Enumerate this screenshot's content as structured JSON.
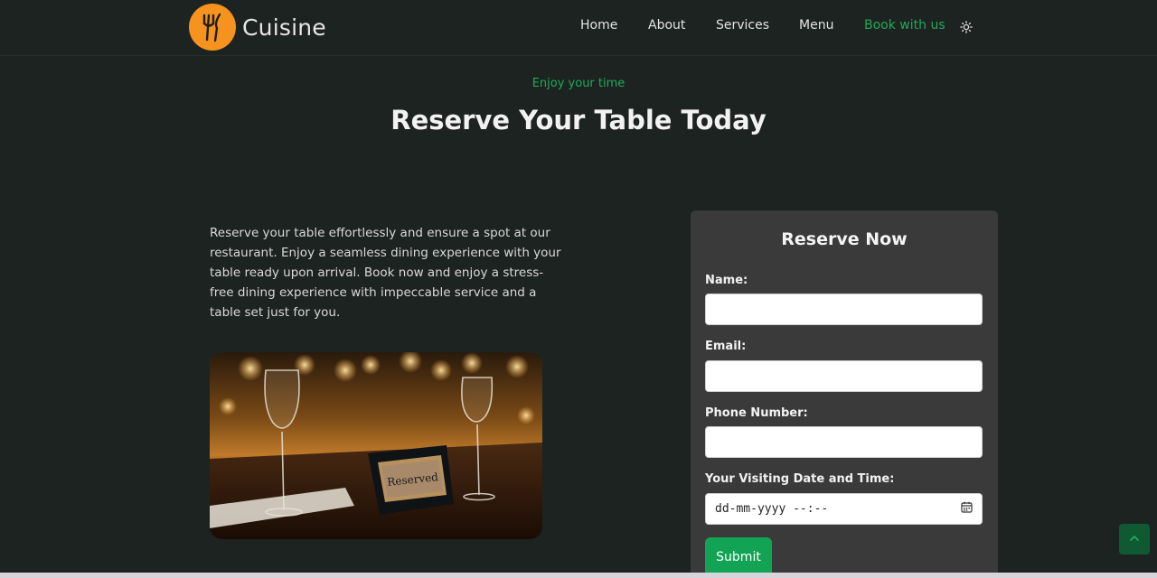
{
  "brand": {
    "name": "Cuisine"
  },
  "nav": {
    "items": [
      {
        "label": "Home"
      },
      {
        "label": "About"
      },
      {
        "label": "Services"
      },
      {
        "label": "Menu"
      },
      {
        "label": "Book with us"
      }
    ],
    "active": "Book with us"
  },
  "hero": {
    "eyebrow": "Enjoy your time",
    "title": "Reserve Your Table Today"
  },
  "intro": {
    "text": "Reserve your table effortlessly and ensure a spot at our restaurant. Enjoy a seamless dining experience with your table ready upon arrival. Book now and enjoy a stress-free dining experience with impeccable service and a table set just for you."
  },
  "photo": {
    "sign_text": "Reserved"
  },
  "form": {
    "title": "Reserve Now",
    "name_label": "Name:",
    "email_label": "Email:",
    "phone_label": "Phone Number:",
    "datetime_label": "Your Visiting Date and Time:",
    "datetime_placeholder": "dd-mm-yyyy --:--",
    "submit_label": "Submit"
  },
  "colors": {
    "background": "#1d2320",
    "accent": "#1fab5b",
    "logo": "#f5931e",
    "card": "#3a3a3a",
    "button": "#12a454"
  },
  "icons": {
    "logo": "fork-knife-icon",
    "theme": "sun-icon",
    "calendar": "calendar-icon",
    "back_to_top": "chevron-up-icon"
  }
}
